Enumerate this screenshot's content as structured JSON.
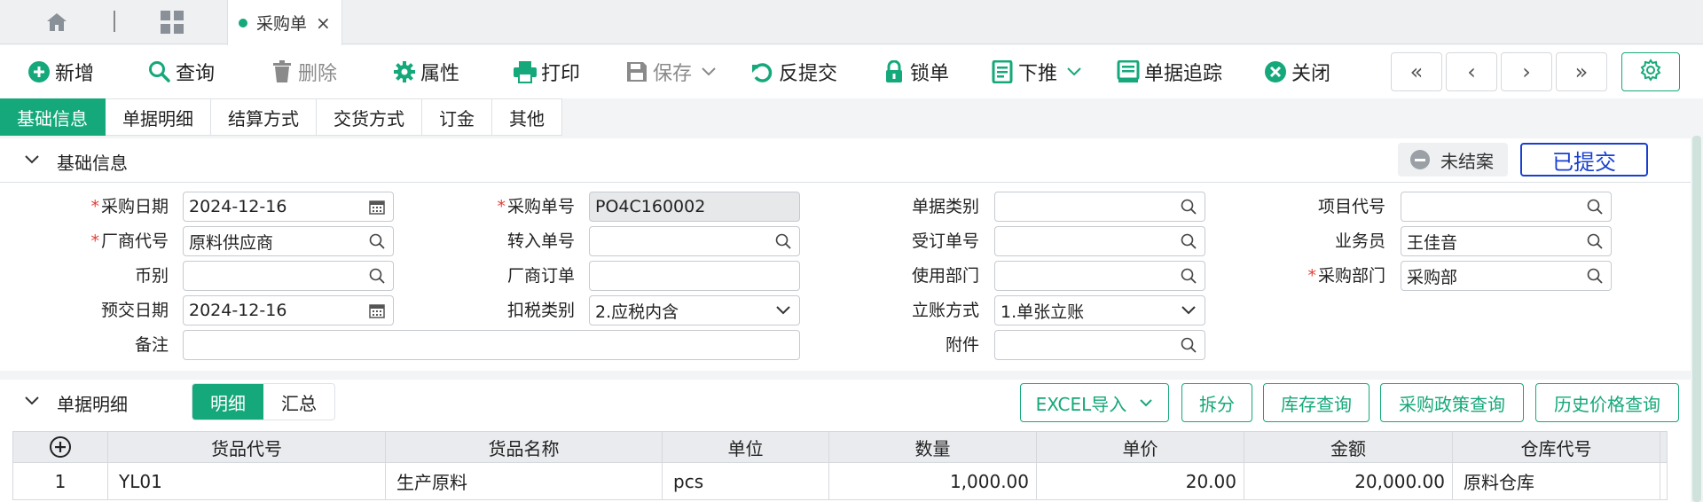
{
  "topbar": {
    "doc_tab_label": "采购单",
    "close_glyph": "×",
    "home_icon": "home-icon",
    "apps_icon": "apps-grid-icon"
  },
  "toolbar": {
    "new_label": "新增",
    "query_label": "查询",
    "delete_label": "删除",
    "props_label": "属性",
    "print_label": "打印",
    "save_label": "保存",
    "unsubmit_label": "反提交",
    "lock_label": "锁单",
    "push_label": "下推",
    "trace_label": "单据追踪",
    "close_label": "关闭",
    "nav_first": "«",
    "nav_prev": "‹",
    "nav_next": "›",
    "nav_last": "»"
  },
  "section_tabs": [
    "基础信息",
    "单据明细",
    "结算方式",
    "交货方式",
    "订金",
    "其他"
  ],
  "basic": {
    "title": "基础信息",
    "status_open": "未结案",
    "status_submitted": "已提交",
    "labels": {
      "purchase_date": "采购日期",
      "vendor_code": "厂商代号",
      "currency": "币别",
      "expected_date": "预交日期",
      "remark": "备注",
      "purchase_no": "采购单号",
      "transfer_no": "转入单号",
      "vendor_order": "厂商订单",
      "tax_type": "扣税类别",
      "doc_type": "单据类别",
      "order_no": "受订单号",
      "dept_use": "使用部门",
      "account_method": "立账方式",
      "attachment": "附件",
      "project_code": "项目代号",
      "salesperson": "业务员",
      "purchase_dept": "采购部门"
    },
    "values": {
      "purchase_date": "2024-12-16",
      "vendor_code": "原料供应商",
      "currency": "",
      "expected_date": "2024-12-16",
      "remark": "",
      "purchase_no": "PO4C160002",
      "transfer_no": "",
      "vendor_order": "",
      "tax_type": "2.应税内含",
      "doc_type": "",
      "order_no": "",
      "dept_use": "",
      "account_method": "1.单张立账",
      "attachment": "",
      "project_code": "",
      "salesperson": "王佳音",
      "purchase_dept": "采购部"
    }
  },
  "detail": {
    "title": "单据明细",
    "seg_detail": "明细",
    "seg_summary": "汇总",
    "btn_excel": "EXCEL导入",
    "btn_split": "拆分",
    "btn_stock": "库存查询",
    "btn_policy": "采购政策查询",
    "btn_history": "历史价格查询",
    "columns": [
      "货品代号",
      "货品名称",
      "单位",
      "数量",
      "单价",
      "金额",
      "仓库代号"
    ],
    "rows": [
      {
        "index": "1",
        "code": "YL01",
        "name": "生产原料",
        "unit": "pcs",
        "qty": "1,000.00",
        "price": "20.00",
        "amount": "20,000.00",
        "warehouse": "原料仓库"
      }
    ]
  },
  "colors": {
    "accent": "#15a87a",
    "submitted_blue": "#1840d0",
    "required_red": "#e0403a"
  }
}
